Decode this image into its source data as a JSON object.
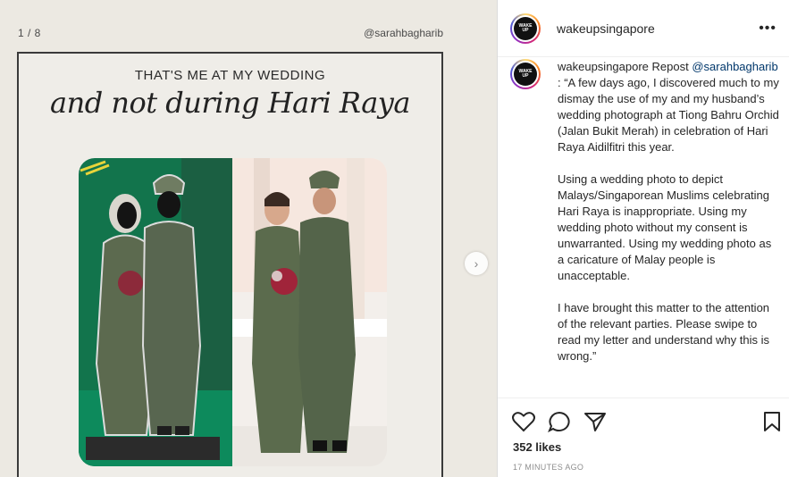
{
  "media": {
    "counter": "1 / 8",
    "author_tag": "@sarahbagharib",
    "heading_caps": "THAT'S ME AT MY WEDDING",
    "heading_script": "and not during Hari Raya",
    "next_icon": "chevron-right-icon"
  },
  "header": {
    "username": "wakeupsingapore",
    "more_icon": "ellipsis-icon"
  },
  "caption": {
    "username": "wakeupsingapore",
    "repost_word": "Repost",
    "mention": "@sarahbagharib",
    "para1_rest": ": “A few days ago, I discovered much to my dismay the use of my and my husband’s wedding photograph at Tiong Bahru Orchid (Jalan Bukit Merah) in celebration of Hari Raya Aidilfitri this year.",
    "para2": "Using a wedding photo to depict Malays/Singaporean Muslims celebrating Hari Raya is inappropriate. Using my wedding photo without my consent is unwarranted. Using my wedding photo as a caricature of Malay people is unacceptable.",
    "para3": "I have brought this matter to the attention of the relevant parties. Please swipe to read my letter and understand why this is wrong.”"
  },
  "actions": {
    "like_icon": "heart-icon",
    "comment_icon": "comment-icon",
    "share_icon": "paper-plane-icon",
    "save_icon": "bookmark-icon",
    "likes": "352 likes",
    "time": "17 MINUTES AGO"
  },
  "colors": {
    "media_bg": "#ece9e2",
    "link": "#00376b",
    "avatar_ring": "#d62976",
    "standee_green": "#0f7a52",
    "outfit": "#5b6b4d"
  }
}
